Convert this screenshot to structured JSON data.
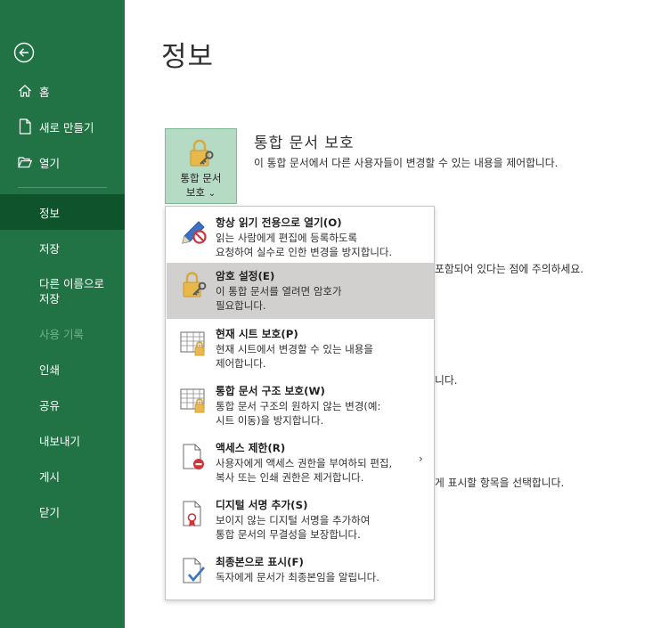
{
  "sidebar": {
    "items": [
      {
        "label": "홈"
      },
      {
        "label": "새로 만들기"
      },
      {
        "label": "열기"
      },
      {
        "label": "정보"
      },
      {
        "label": "저장"
      },
      {
        "label": "다른 이름으로\n저장"
      },
      {
        "label": "사용 기록"
      },
      {
        "label": "인쇄"
      },
      {
        "label": "공유"
      },
      {
        "label": "내보내기"
      },
      {
        "label": "게시"
      },
      {
        "label": "닫기"
      }
    ]
  },
  "main": {
    "title": "정보",
    "protect_tile": {
      "label": "통합 문서\n보호",
      "chevron": "⌄"
    },
    "protect_section": {
      "heading": "통합 문서 보호",
      "description": "이 통합 문서에서 다른 사용자들이 변경할 수 있는 내용을 제어합니다."
    },
    "background_fragments": [
      "포함되어 있다는 점에 주의하세요.",
      "니다.",
      "게 표시할 항목을 선택합니다."
    ]
  },
  "menu": {
    "items": [
      {
        "title": "항상 읽기 전용으로 열기(O)",
        "description": "읽는 사람에게 편집에 등록하도록\n요청하여 실수로 인한 변경을 방지합니다.",
        "icon": "pencil-no-icon"
      },
      {
        "title": "암호 설정(E)",
        "description": "이 통합 문서를 열려면 암호가\n필요합니다.",
        "icon": "lock-key-icon"
      },
      {
        "title": "현재 시트 보호(P)",
        "description": "현재 시트에서 변경할 수 있는 내용을\n제어합니다.",
        "icon": "sheet-lock-icon"
      },
      {
        "title": "통합 문서 구조 보호(W)",
        "description": "통합 문서 구조의 원하지 않는 변경(예:\n시트 이동)을 방지합니다.",
        "icon": "workbook-lock-icon"
      },
      {
        "title": "액세스 제한(R)",
        "description": "사용자에게 액세스 권한을 부여하되 편집,\n복사 또는 인쇄 권한은 제거합니다.",
        "icon": "document-restrict-icon"
      },
      {
        "title": "디지털 서명 추가(S)",
        "description": "보이지 않는 디지털 서명을 추가하여\n통합 문서의 무결성을 보장합니다.",
        "icon": "document-ribbon-icon"
      },
      {
        "title": "최종본으로 표시(F)",
        "description": "독자에게 문서가 최종본임을 알립니다.",
        "icon": "document-check-icon"
      }
    ],
    "submenu_arrow": "›"
  },
  "colors": {
    "sidebar_bg": "#217346",
    "sidebar_active": "#0f532c",
    "tile_bg": "#b6dbc4",
    "menu_hover": "#d2d0ce",
    "lock_gold": "#e8b94a"
  }
}
